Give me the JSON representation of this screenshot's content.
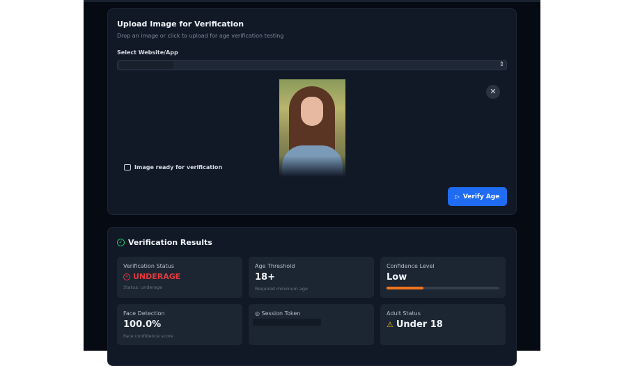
{
  "upload": {
    "title": "Upload Image for Verification",
    "subtitle": "Drop an image or click to upload for age verification testing",
    "select_label": "Select Website/App",
    "ready_text": "Image ready for verification",
    "verify_button": "Verify Age"
  },
  "results": {
    "title": "Verification Results",
    "verification_status": {
      "label": "Verification Status",
      "value": "UNDERAGE",
      "sub": "Status: underage",
      "color": "#e5383b"
    },
    "age_threshold": {
      "label": "Age Threshold",
      "value": "18+",
      "sub": "Required minimum age"
    },
    "confidence": {
      "label": "Confidence Level",
      "value": "Low",
      "percent": 33,
      "color": "#f2741c"
    },
    "face_detection": {
      "label": "Face Detection",
      "value": "100.0%",
      "sub": "Face confidence score"
    },
    "session_token": {
      "label": "Session Token"
    },
    "adult_status": {
      "label": "Adult Status",
      "value": "Under 18"
    }
  }
}
